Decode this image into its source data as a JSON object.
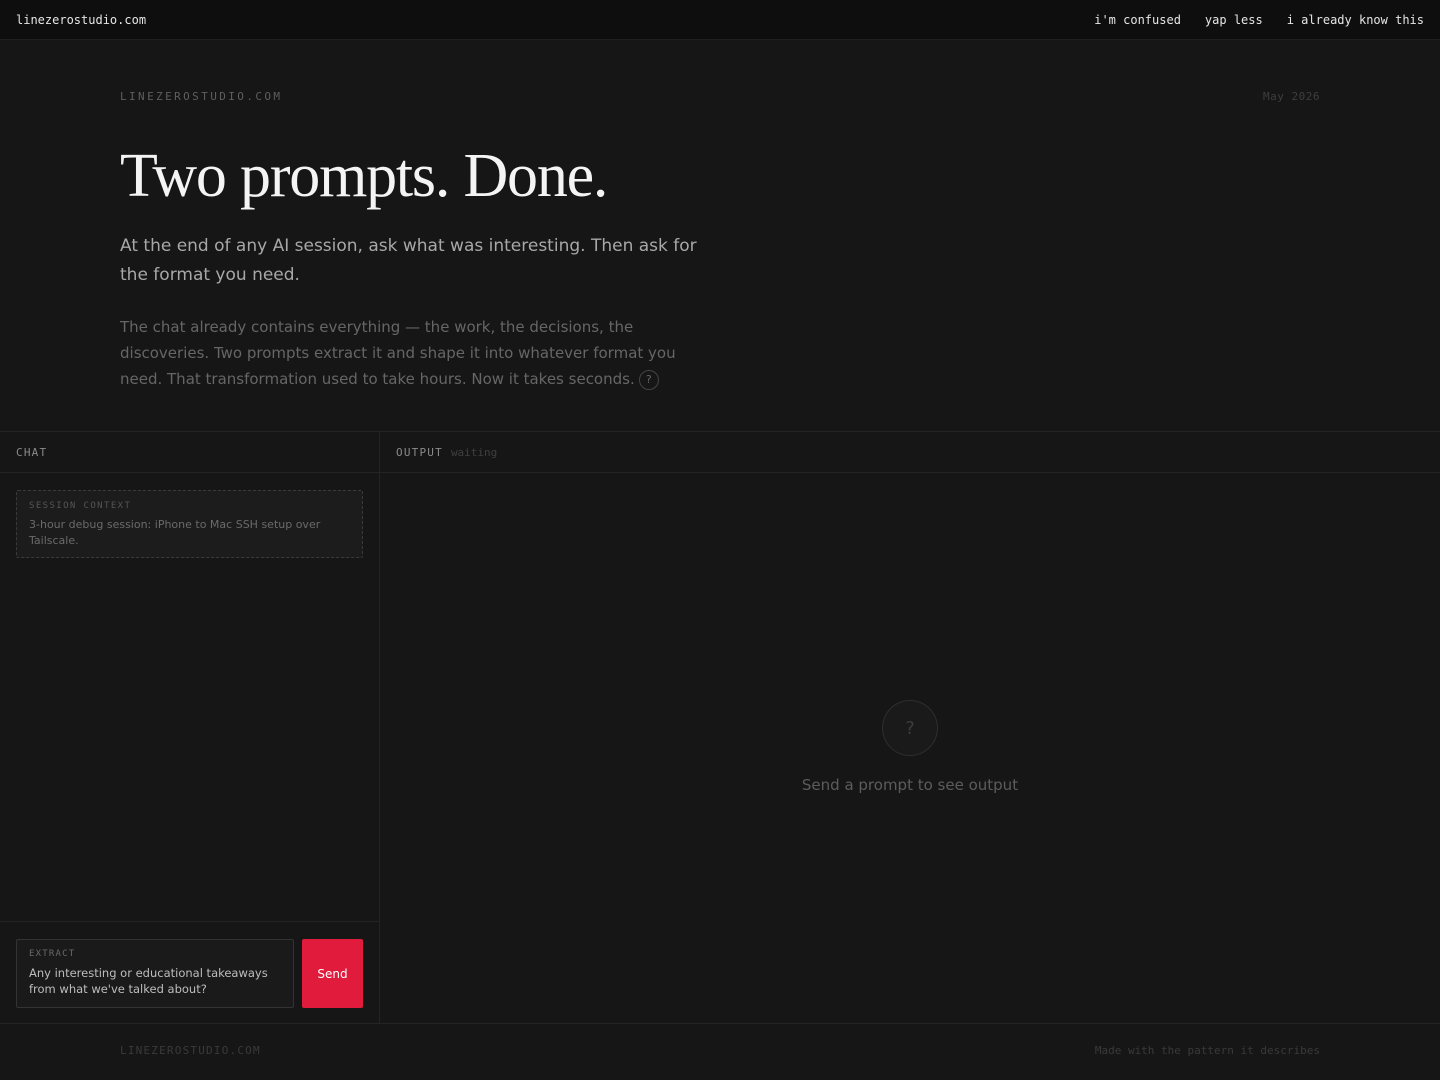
{
  "nav": {
    "brand": "linezerostudio.com",
    "links": [
      "i'm confused",
      "yap less",
      "i already know this"
    ]
  },
  "hero": {
    "eyebrow": "LINEZEROSTUDIO.COM",
    "date": "May 2026",
    "title": "Two prompts. Done.",
    "lede": "At the end of any AI session, ask what was interesting. Then ask for the format you need.",
    "body": "The chat already contains everything — the work, the decisions, the discoveries. Two prompts extract it and shape it into whatever format you need. That transformation used to take hours. Now it takes seconds.",
    "help_glyph": "?"
  },
  "chat": {
    "title": "CHAT",
    "context": {
      "label": "SESSION CONTEXT",
      "text": "3-hour debug session: iPhone to Mac SSH setup over Tailscale."
    },
    "composer": {
      "label": "EXTRACT",
      "prompt": "Any interesting or educational takeaways from what we've talked about?",
      "send_label": "Send",
      "send_color": "#e01b3c"
    }
  },
  "output": {
    "title": "OUTPUT",
    "status": "waiting",
    "empty_icon": "?",
    "empty_text": "Send a prompt to see output"
  },
  "footer": {
    "brand": "LINEZEROSTUDIO.COM",
    "note": "Made with the pattern it describes"
  }
}
